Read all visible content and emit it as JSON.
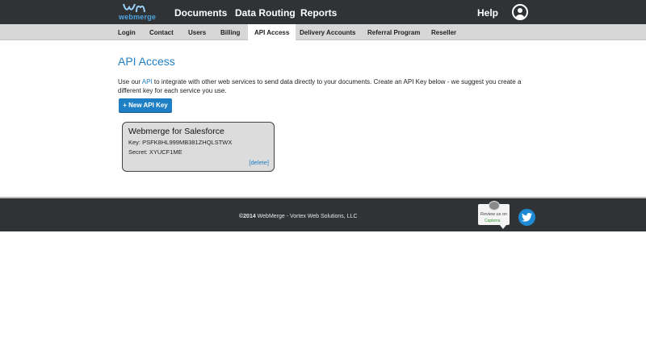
{
  "brand": {
    "logo_text": "webmerge"
  },
  "topnav": {
    "documents": "Documents",
    "data_routing": "Data Routing",
    "reports": "Reports",
    "help": "Help"
  },
  "subnav": {
    "login": "Login",
    "contact": "Contact",
    "users": "Users",
    "billing": "Billing",
    "api_access": "API Access",
    "delivery_accounts": "Delivery Accounts",
    "referral_program": "Referral Program",
    "reseller": "Reseller",
    "active": "API Access"
  },
  "main": {
    "title": "API Access",
    "intro_before": "Use our ",
    "intro_link": "API",
    "intro_after": " to integrate with other web services to send data directly to your documents. Create an API Key below - we suggest you create a different key for each service you use.",
    "new_key_label": "+ New API Key"
  },
  "api_keys": [
    {
      "name": "Webmerge for Salesforce",
      "key_line": "Key: PSFK8HL999MB381ZHQLSTWX",
      "secret_line": "Secret: XYUCF1ME",
      "delete_label": "[delete]"
    }
  ],
  "footer": {
    "copyright_year": "©2014",
    "copyright_rest": " WebMerge - Vortex Web Solutions, LLC",
    "review_text": "Review us on",
    "review_brand": "Capterra"
  },
  "colors": {
    "accent": "#1f7fc4",
    "header_bg": "#2f3336",
    "subnav_bg": "#d7d7d7",
    "card_bg": "#dcdcdc"
  },
  "icons": {
    "user": "user-avatar-icon",
    "twitter": "twitter-icon",
    "review": "review-badge-icon"
  }
}
